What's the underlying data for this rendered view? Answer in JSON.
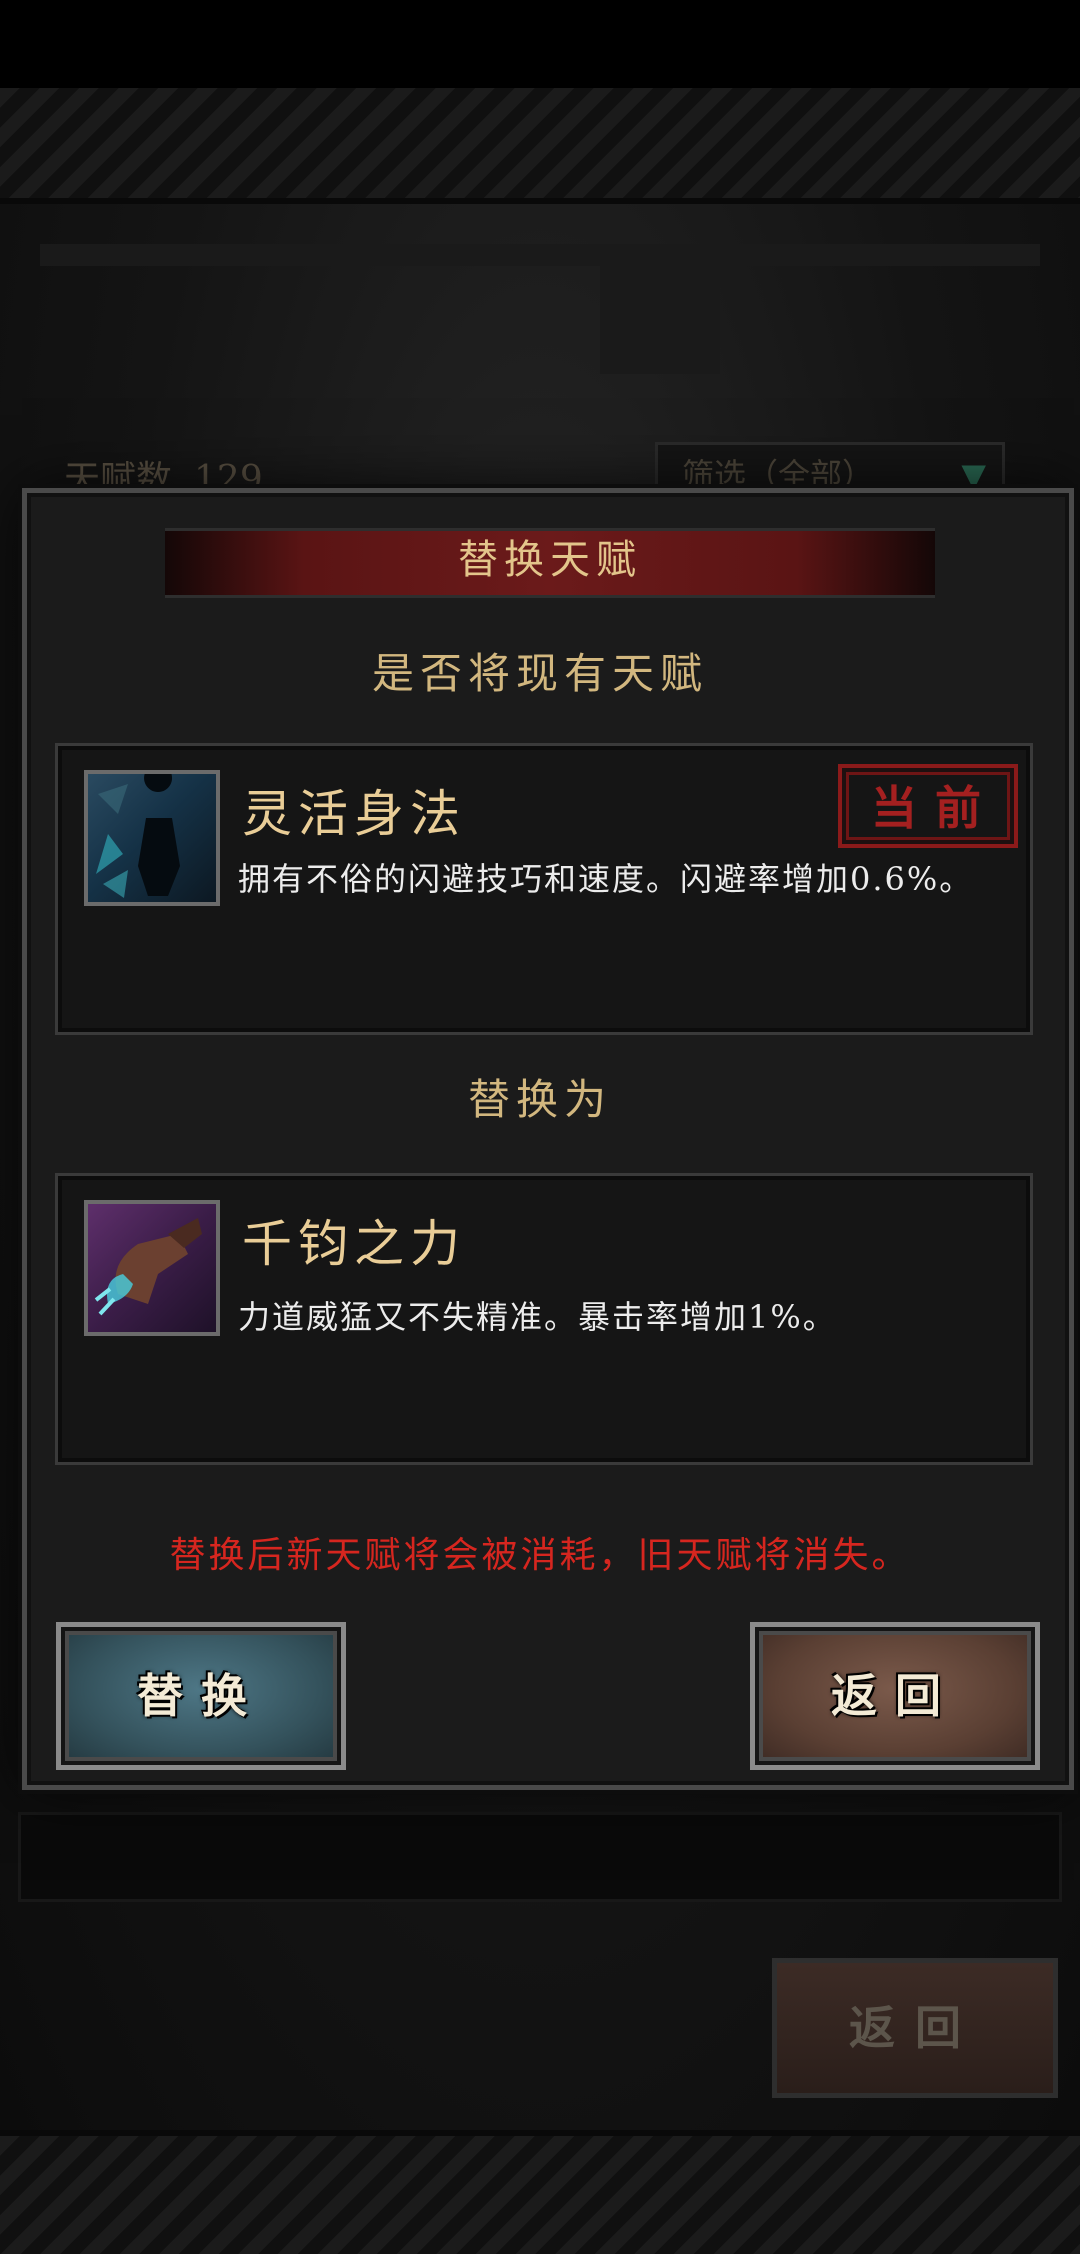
{
  "background": {
    "talent_count_label": "天赋数",
    "talent_count_value": "129",
    "filter_label": "筛选（全部）",
    "back_label": "返回"
  },
  "dialog": {
    "title": "替换天赋",
    "prompt_current": "是否将现有天赋",
    "current_talent": {
      "name": "灵活身法",
      "description": "拥有不俗的闪避技巧和速度。闪避率增加0.6%。",
      "badge": "当前",
      "icon": "silhouette-dodge-icon"
    },
    "prompt_replace": "替换为",
    "new_talent": {
      "name": "千钧之力",
      "description": "力道威猛又不失精准。暴击率增加1%。",
      "icon": "fist-strike-icon"
    },
    "warning": "替换后新天赋将会被消耗，旧天赋将消失。",
    "replace_button": "替换",
    "back_button": "返回"
  },
  "colors": {
    "gold_text": "#e9cd97",
    "warning_red": "#d6261f",
    "stamp_red": "#a42020",
    "replace_button": "#34525c",
    "back_button": "#5a3f33"
  }
}
